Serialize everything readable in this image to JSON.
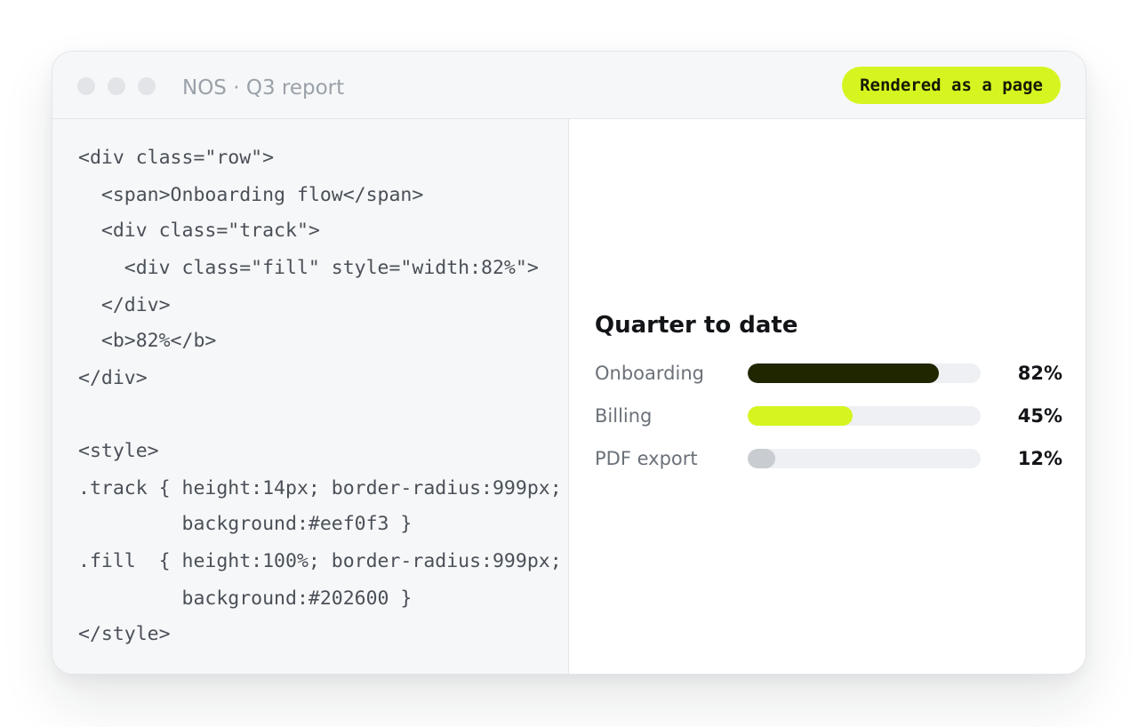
{
  "window": {
    "title": "NOS · Q3 report",
    "badge": "Rendered as a page"
  },
  "code": {
    "lines": [
      "<div class=\"row\">",
      "  <span>Onboarding flow</span>",
      "  <div class=\"track\">",
      "    <div class=\"fill\" style=\"width:82%\">",
      "  </div>",
      "  <b>82%</b>",
      "</div>",
      "",
      "<style>",
      ".track { height:14px; border-radius:999px;",
      "         background:#eef0f3 }",
      ".fill  { height:100%; border-radius:999px;",
      "         background:#202600 }",
      "</style>"
    ]
  },
  "preview": {
    "title": "Quarter to date",
    "bars": [
      {
        "label": "Onboarding",
        "value_text": "82%",
        "value": 0.82,
        "color": "#202600"
      },
      {
        "label": "Billing",
        "value_text": "45%",
        "value": 0.45,
        "color": "#d6f520"
      },
      {
        "label": "PDF export",
        "value_text": "12%",
        "value": 0.12,
        "color": "#c9cdd2"
      }
    ]
  },
  "colors": {
    "accent": "#d6f520",
    "dark_fill": "#202600",
    "track": "#eef0f3"
  }
}
